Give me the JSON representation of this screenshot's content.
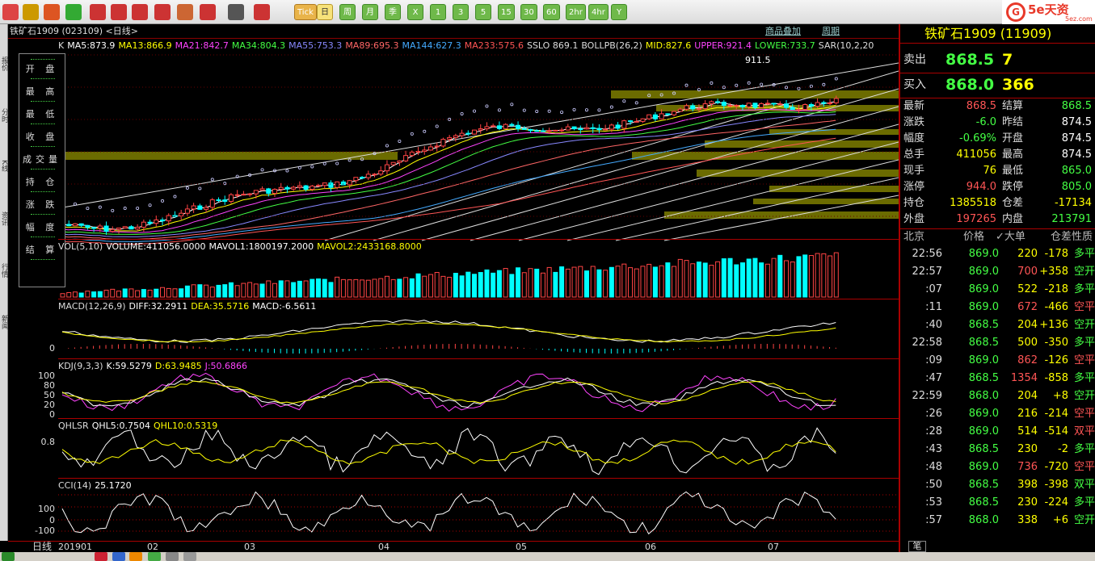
{
  "toolbar": {
    "buttons": [
      {
        "name": "home-icon"
      },
      {
        "name": "book-icon"
      },
      {
        "name": "report-icon"
      },
      {
        "name": "refresh-icon"
      },
      {
        "name": "zoom-in-icon"
      },
      {
        "name": "zoom-out-icon"
      },
      {
        "name": "window-icon"
      },
      {
        "name": "pen-icon"
      },
      {
        "name": "eraser-icon"
      },
      {
        "name": "filter-icon"
      },
      {
        "name": "list-icon"
      },
      {
        "name": "line-chart-icon"
      }
    ],
    "period_tick": "Tick",
    "periods": [
      "日",
      "周",
      "月",
      "季",
      "X",
      "1",
      "3",
      "5",
      "15",
      "30",
      "60",
      "2hr",
      "4hr",
      "Y"
    ],
    "active_period": "日"
  },
  "brand": {
    "mark": "G",
    "name": "5e天资",
    "sub": "5ez.com"
  },
  "left_strip": {
    "labels": [
      "报价",
      "分时",
      "K线",
      "资讯",
      "行情",
      "新闻"
    ]
  },
  "chart": {
    "header_code": "铁矿石1909 (023109) <日线>",
    "links": [
      "商品叠加",
      "周期"
    ],
    "indicators": [
      {
        "text": "K",
        "color": "#dddddd"
      },
      {
        "text": "MA5:873.9",
        "color": "#ffffff"
      },
      {
        "text": "MA13:866.9",
        "color": "#ffff00"
      },
      {
        "text": "MA21:842.7",
        "color": "#ff44ff"
      },
      {
        "text": "MA34:804.3",
        "color": "#44ff44"
      },
      {
        "text": "MA55:753.3",
        "color": "#8888ff"
      },
      {
        "text": "MA89:695.3",
        "color": "#ff6666"
      },
      {
        "text": "MA144:627.3",
        "color": "#44aaff"
      },
      {
        "text": "MA233:575.6",
        "color": "#ff5555"
      },
      {
        "text": "SSLO 869.1",
        "color": "#dddddd"
      },
      {
        "text": "BOLLPB(26,2)",
        "color": "#dddddd"
      },
      {
        "text": "MID:827.6",
        "color": "#ffff00"
      },
      {
        "text": "UPPER:921.4",
        "color": "#ff44ff"
      },
      {
        "text": "LOWER:733.7",
        "color": "#44ff44"
      },
      {
        "text": "SAR(10,2,20",
        "color": "#dddddd"
      }
    ],
    "peak_label": "911.5",
    "ohlc_labels": [
      "开 盘",
      "最 高",
      "最 低",
      "收 盘",
      "成交量",
      "持 仓",
      "涨 跌",
      "幅 度",
      "结 算"
    ],
    "panels": {
      "vol": {
        "label": "VOL(5,10)",
        "items": [
          {
            "text": "VOLUME:411056.0000",
            "color": "#ffffff"
          },
          {
            "text": "MAVOL1:1800197.2000",
            "color": "#ffffff"
          },
          {
            "text": "MAVOL2:2433168.8000",
            "color": "#ffff00"
          }
        ]
      },
      "macd": {
        "label": "MACD(12,26,9)",
        "items": [
          {
            "text": "DIFF:32.2911",
            "color": "#ffffff"
          },
          {
            "text": "DEA:35.5716",
            "color": "#ffff00"
          },
          {
            "text": "MACD:-6.5611",
            "color": "#ffffff"
          }
        ],
        "axis": [
          "0"
        ]
      },
      "kdj": {
        "label": "KDJ(9,3,3)",
        "items": [
          {
            "text": "K:59.5279",
            "color": "#ffffff"
          },
          {
            "text": "D:63.9485",
            "color": "#ffff00"
          },
          {
            "text": "J:50.6866",
            "color": "#ff44ff"
          }
        ],
        "axis": [
          "100",
          "80",
          "50",
          "20",
          "0"
        ]
      },
      "qhlsr": {
        "label": "QHLSR",
        "items": [
          {
            "text": "QHL5:0.7504",
            "color": "#ffffff"
          },
          {
            "text": "QHL10:0.5319",
            "color": "#ffff00"
          }
        ],
        "axis": [
          "0.8"
        ]
      },
      "cci": {
        "label": "CCI(14)",
        "items": [
          {
            "text": "25.1720",
            "color": "#ffffff"
          }
        ],
        "axis": [
          "100",
          "0",
          "-100"
        ]
      }
    },
    "date_labels": [
      "201901",
      "02",
      "03",
      "04",
      "05",
      "06",
      "07"
    ],
    "tab_day": "日线"
  },
  "panel": {
    "title": "铁矿石1909 (11909)",
    "sell": {
      "label": "卖出",
      "price": "868.5",
      "qty": "7"
    },
    "buy": {
      "label": "买入",
      "price": "868.0",
      "qty": "366"
    },
    "quote_rows": [
      {
        "k": "最新",
        "v": "868.5",
        "vc": "#ff5555",
        "k2": "结算",
        "v2": "868.5",
        "v2c": "#44ff44"
      },
      {
        "k": "涨跌",
        "v": "-6.0",
        "vc": "#44ff44",
        "k2": "昨结",
        "v2": "874.5",
        "v2c": "#ffffff"
      },
      {
        "k": "幅度",
        "v": "-0.69%",
        "vc": "#44ff44",
        "k2": "开盘",
        "v2": "874.5",
        "v2c": "#ffffff"
      },
      {
        "k": "总手",
        "v": "411056",
        "vc": "#ffff00",
        "k2": "最高",
        "v2": "874.5",
        "v2c": "#ffffff"
      },
      {
        "k": "现手",
        "v": "76",
        "vc": "#ffff00",
        "k2": "最低",
        "v2": "865.0",
        "v2c": "#44ff44"
      },
      {
        "k": "涨停",
        "v": "944.0",
        "vc": "#ff5555",
        "k2": "跌停",
        "v2": "805.0",
        "v2c": "#44ff44"
      },
      {
        "k": "持仓",
        "v": "1385518",
        "vc": "#ffff00",
        "k2": "仓差",
        "v2": "-17134",
        "v2c": "#ffff00"
      },
      {
        "k": "外盘",
        "v": "197265",
        "vc": "#ff5555",
        "k2": "内盘",
        "v2": "213791",
        "v2c": "#44ff44"
      }
    ],
    "trade_headers": [
      "北京",
      "价格",
      "✓大单",
      "仓差",
      "性质"
    ],
    "trades": [
      {
        "time": "22:56",
        "price": "869.0",
        "vol": "220",
        "oi": "-178",
        "nature": "多平",
        "color": "#44ff44"
      },
      {
        "time": "22:57",
        "price": "869.0",
        "vol": "700",
        "oi": "+358",
        "nature": "空开",
        "color": "#44ff44"
      },
      {
        "time": ":07",
        "price": "869.0",
        "vol": "522",
        "oi": "-218",
        "nature": "多平",
        "color": "#44ff44"
      },
      {
        "time": ":11",
        "price": "869.0",
        "vol": "672",
        "oi": "-466",
        "nature": "空平",
        "color": "#ff5555"
      },
      {
        "time": ":40",
        "price": "868.5",
        "vol": "204",
        "oi": "+136",
        "nature": "空开",
        "color": "#44ff44"
      },
      {
        "time": "22:58",
        "price": "868.5",
        "vol": "500",
        "oi": "-350",
        "nature": "多平",
        "color": "#44ff44"
      },
      {
        "time": ":09",
        "price": "869.0",
        "vol": "862",
        "oi": "-126",
        "nature": "空平",
        "color": "#ff5555"
      },
      {
        "time": ":47",
        "price": "868.5",
        "vol": "1354",
        "oi": "-858",
        "nature": "多平",
        "color": "#44ff44"
      },
      {
        "time": "22:59",
        "price": "868.0",
        "vol": "204",
        "oi": "+8",
        "nature": "空开",
        "color": "#44ff44"
      },
      {
        "time": ":26",
        "price": "869.0",
        "vol": "216",
        "oi": "-214",
        "nature": "空平",
        "color": "#ff5555"
      },
      {
        "time": ":28",
        "price": "869.0",
        "vol": "514",
        "oi": "-514",
        "nature": "双平",
        "color": "#ff5555"
      },
      {
        "time": ":43",
        "price": "868.5",
        "vol": "230",
        "oi": "-2",
        "nature": "多平",
        "color": "#44ff44"
      },
      {
        "time": ":48",
        "price": "869.0",
        "vol": "736",
        "oi": "-720",
        "nature": "空平",
        "color": "#ff5555"
      },
      {
        "time": ":50",
        "price": "868.5",
        "vol": "398",
        "oi": "-398",
        "nature": "双平",
        "color": "#44ff44"
      },
      {
        "time": ":53",
        "price": "868.5",
        "vol": "230",
        "oi": "-224",
        "nature": "多平",
        "color": "#44ff44"
      },
      {
        "time": ":57",
        "price": "868.0",
        "vol": "338",
        "oi": "+6",
        "nature": "空开",
        "color": "#44ff44"
      }
    ],
    "bottom_tab": "笔"
  }
}
